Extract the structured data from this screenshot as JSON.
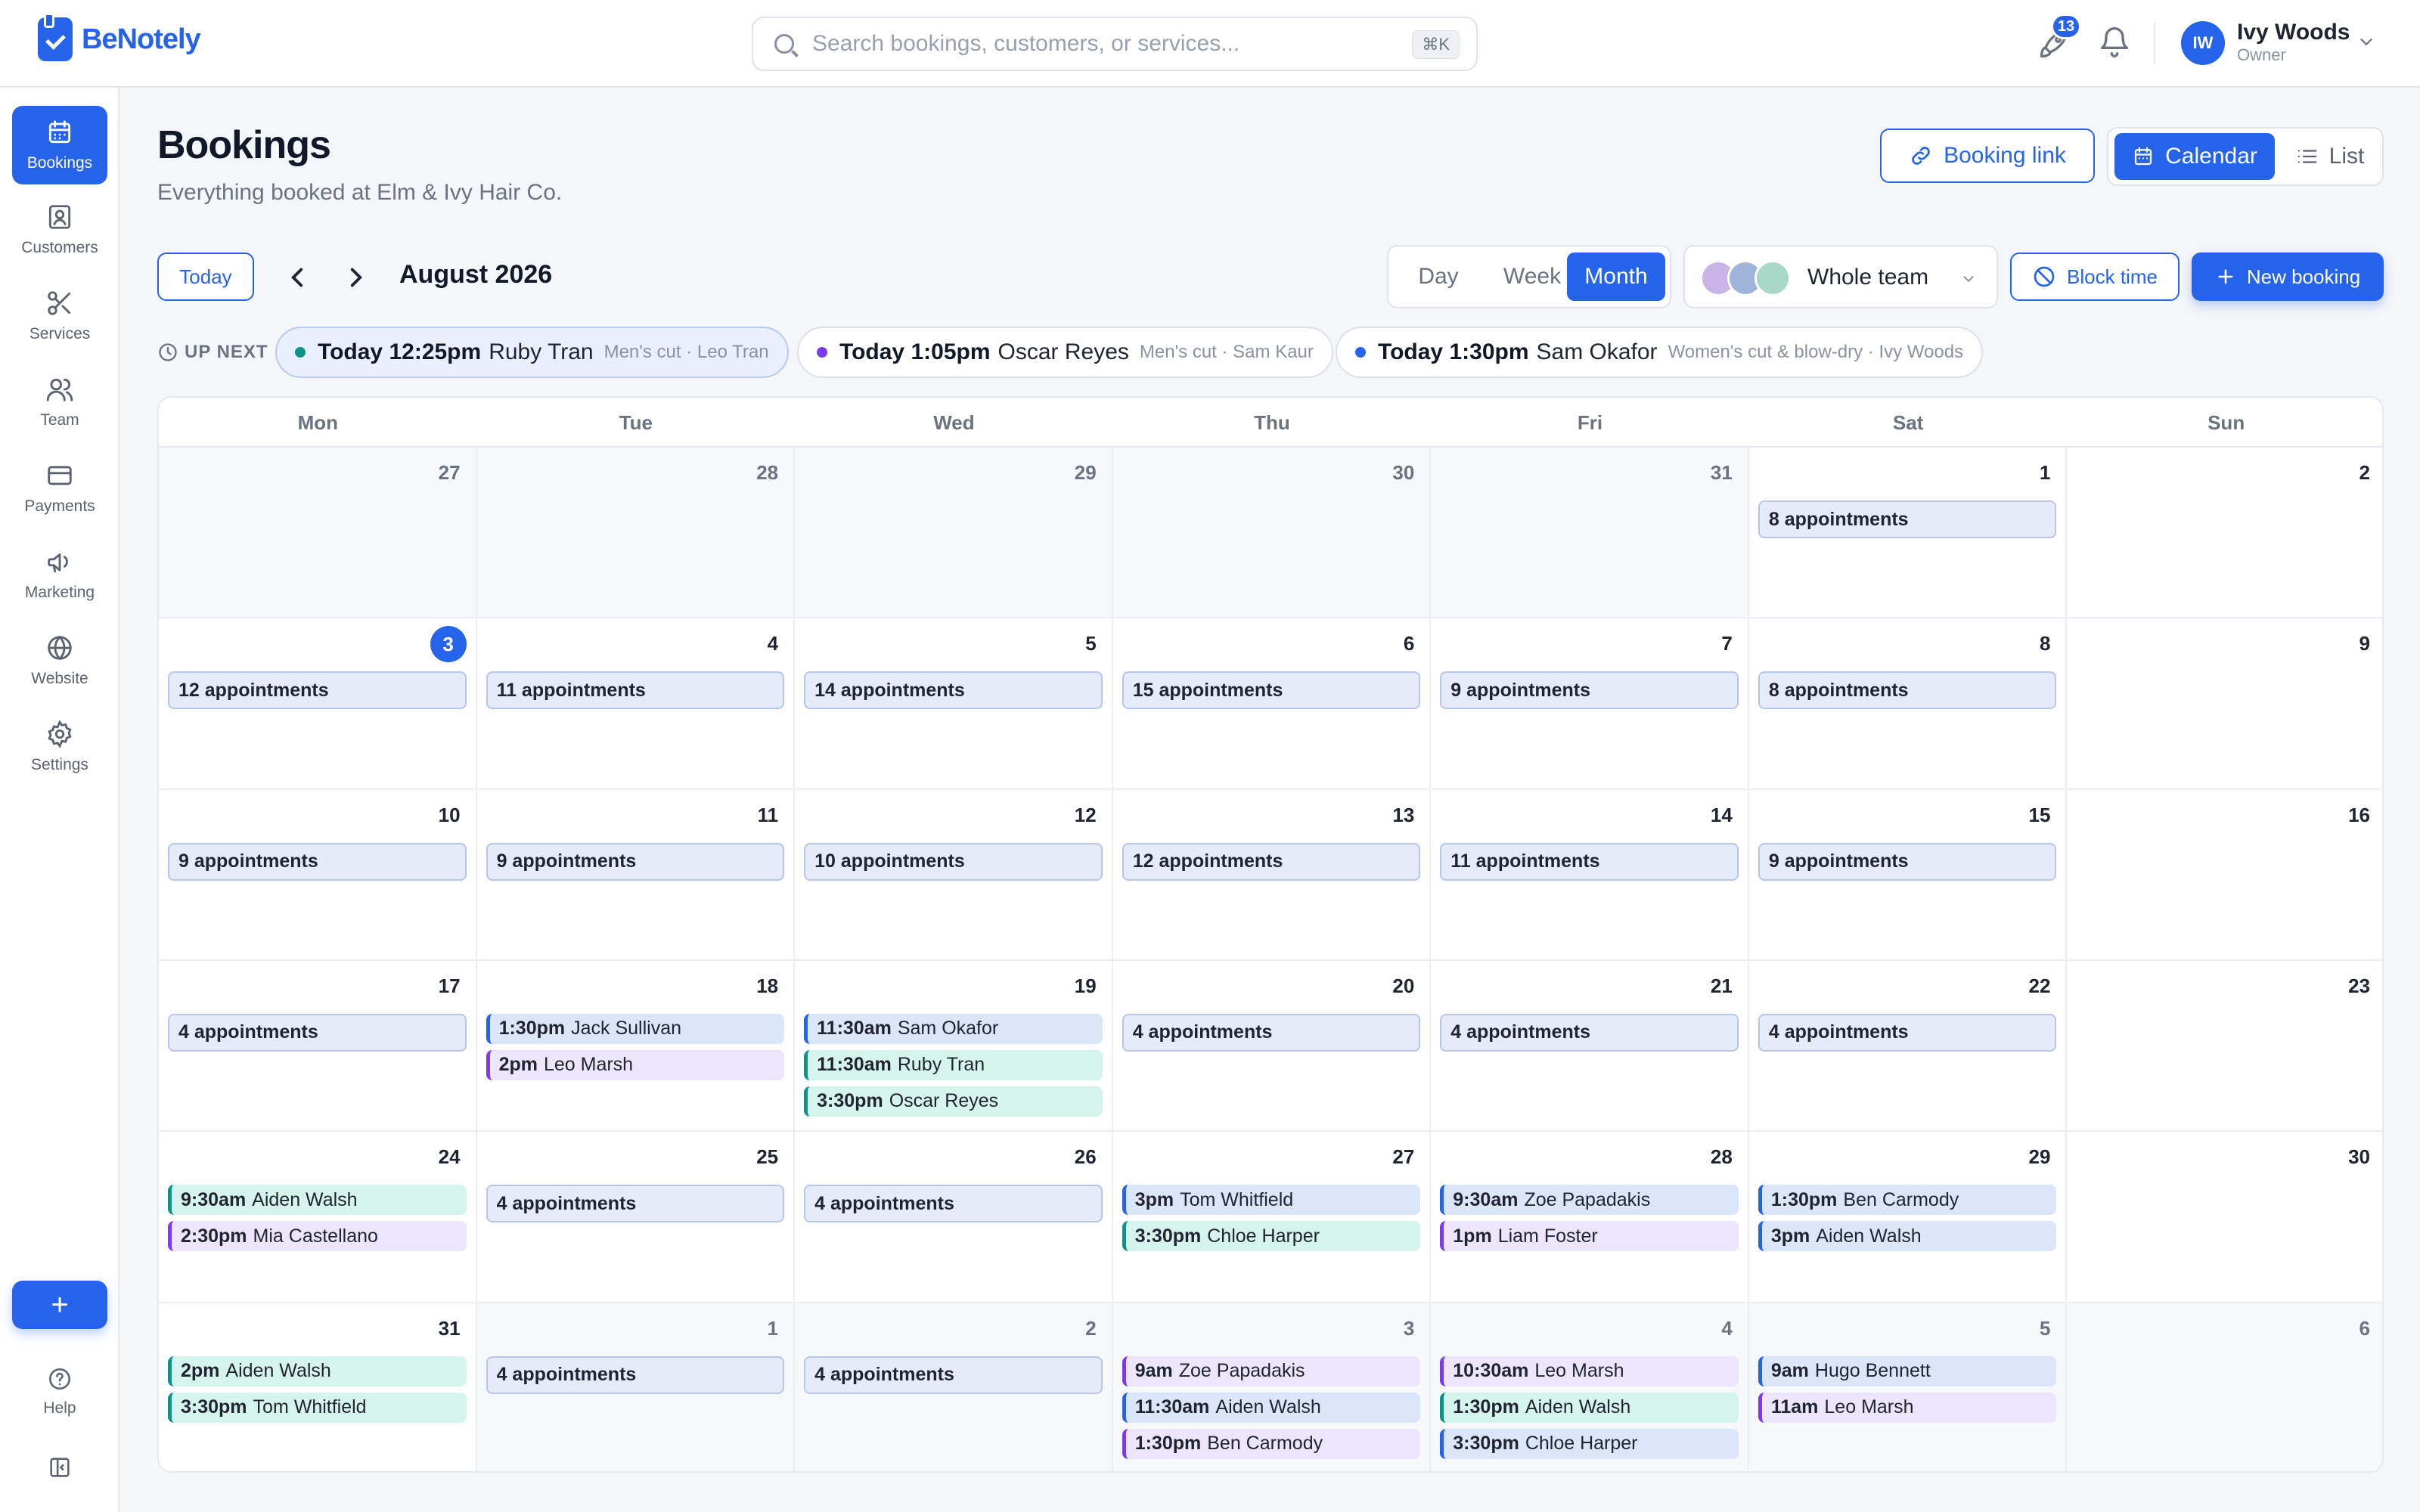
{
  "app": {
    "name": "BeNotely"
  },
  "search": {
    "placeholder": "Search bookings, customers, or services...",
    "shortcut": "⌘K"
  },
  "topbar": {
    "notifications_count": "13"
  },
  "user": {
    "initials": "IW",
    "name": "Ivy Woods",
    "role": "Owner"
  },
  "sidebar": {
    "items": [
      {
        "label": "Bookings",
        "icon": "calendar-icon",
        "active": true
      },
      {
        "label": "Customers",
        "icon": "contact-icon"
      },
      {
        "label": "Services",
        "icon": "scissors-icon"
      },
      {
        "label": "Team",
        "icon": "users-icon"
      },
      {
        "label": "Payments",
        "icon": "credit-card-icon"
      },
      {
        "label": "Marketing",
        "icon": "megaphone-icon"
      },
      {
        "label": "Website",
        "icon": "globe-icon"
      },
      {
        "label": "Settings",
        "icon": "gear-icon"
      }
    ],
    "add_label": "+",
    "help_label": "Help"
  },
  "header": {
    "title": "Bookings",
    "subtitle": "Everything booked at Elm & Ivy Hair Co.",
    "booking_link_label": "Booking link",
    "view_calendar_label": "Calendar",
    "view_list_label": "List"
  },
  "controls": {
    "today_label": "Today",
    "month_label": "August 2026",
    "range_day": "Day",
    "range_week": "Week",
    "range_month": "Month",
    "team_label": "Whole team",
    "block_time_label": "Block time",
    "new_booking_label": "New booking"
  },
  "up_next": {
    "label": "UP NEXT",
    "items": [
      {
        "time": "Today 12:25pm",
        "name": "Ruby Tran",
        "detail": "Men's cut · Leo Tran",
        "color": "#0d9488"
      },
      {
        "time": "Today 1:05pm",
        "name": "Oscar Reyes",
        "detail": "Men's cut · Sam Kaur",
        "color": "#7c3aed"
      },
      {
        "time": "Today 1:30pm",
        "name": "Sam Okafor",
        "detail": "Women's cut & blow-dry · Ivy Woods",
        "color": "#2563eb"
      }
    ]
  },
  "calendar": {
    "weekdays": [
      "Mon",
      "Tue",
      "Wed",
      "Thu",
      "Fri",
      "Sat",
      "Sun"
    ],
    "days": [
      {
        "date": "27",
        "muted": true
      },
      {
        "date": "28",
        "muted": true
      },
      {
        "date": "29",
        "muted": true
      },
      {
        "date": "30",
        "muted": true
      },
      {
        "date": "31",
        "muted": true
      },
      {
        "date": "1",
        "count": "8 appointments"
      },
      {
        "date": "2"
      },
      {
        "date": "3",
        "today": true,
        "count": "12 appointments"
      },
      {
        "date": "4",
        "count": "11 appointments"
      },
      {
        "date": "5",
        "count": "14 appointments"
      },
      {
        "date": "6",
        "count": "15 appointments"
      },
      {
        "date": "7",
        "count": "9 appointments"
      },
      {
        "date": "8",
        "count": "8 appointments"
      },
      {
        "date": "9"
      },
      {
        "date": "10",
        "count": "9 appointments"
      },
      {
        "date": "11",
        "count": "9 appointments"
      },
      {
        "date": "12",
        "count": "10 appointments"
      },
      {
        "date": "13",
        "count": "12 appointments"
      },
      {
        "date": "14",
        "count": "11 appointments"
      },
      {
        "date": "15",
        "count": "9 appointments"
      },
      {
        "date": "16"
      },
      {
        "date": "17",
        "count": "4 appointments"
      },
      {
        "date": "18",
        "events": [
          {
            "time": "1:30pm",
            "name": "Jack Sullivan",
            "color": "blue"
          },
          {
            "time": "2pm",
            "name": "Leo Marsh",
            "color": "purple"
          }
        ]
      },
      {
        "date": "19",
        "events": [
          {
            "time": "11:30am",
            "name": "Sam Okafor",
            "color": "blue"
          },
          {
            "time": "11:30am",
            "name": "Ruby Tran",
            "color": "teal"
          },
          {
            "time": "3:30pm",
            "name": "Oscar Reyes",
            "color": "teal"
          }
        ]
      },
      {
        "date": "20",
        "count": "4 appointments"
      },
      {
        "date": "21",
        "count": "4 appointments"
      },
      {
        "date": "22",
        "count": "4 appointments"
      },
      {
        "date": "23"
      },
      {
        "date": "24",
        "events": [
          {
            "time": "9:30am",
            "name": "Aiden Walsh",
            "color": "teal"
          },
          {
            "time": "2:30pm",
            "name": "Mia Castellano",
            "color": "purple"
          }
        ]
      },
      {
        "date": "25",
        "count": "4 appointments"
      },
      {
        "date": "26",
        "count": "4 appointments"
      },
      {
        "date": "27",
        "events": [
          {
            "time": "3pm",
            "name": "Tom Whitfield",
            "color": "blue"
          },
          {
            "time": "3:30pm",
            "name": "Chloe Harper",
            "color": "teal"
          }
        ]
      },
      {
        "date": "28",
        "events": [
          {
            "time": "9:30am",
            "name": "Zoe Papadakis",
            "color": "blue"
          },
          {
            "time": "1pm",
            "name": "Liam Foster",
            "color": "purple"
          }
        ]
      },
      {
        "date": "29",
        "events": [
          {
            "time": "1:30pm",
            "name": "Ben Carmody",
            "color": "blue"
          },
          {
            "time": "3pm",
            "name": "Aiden Walsh",
            "color": "blue"
          }
        ]
      },
      {
        "date": "30"
      },
      {
        "date": "31",
        "events": [
          {
            "time": "2pm",
            "name": "Aiden Walsh",
            "color": "teal"
          },
          {
            "time": "3:30pm",
            "name": "Tom Whitfield",
            "color": "teal"
          }
        ]
      },
      {
        "date": "1",
        "muted": true,
        "count": "4 appointments"
      },
      {
        "date": "2",
        "muted": true,
        "count": "4 appointments"
      },
      {
        "date": "3",
        "muted": true,
        "events": [
          {
            "time": "9am",
            "name": "Zoe Papadakis",
            "color": "purple"
          },
          {
            "time": "11:30am",
            "name": "Aiden Walsh",
            "color": "blue"
          },
          {
            "time": "1:30pm",
            "name": "Ben Carmody",
            "color": "purple"
          }
        ]
      },
      {
        "date": "4",
        "muted": true,
        "events": [
          {
            "time": "10:30am",
            "name": "Leo Marsh",
            "color": "purple"
          },
          {
            "time": "1:30pm",
            "name": "Aiden Walsh",
            "color": "teal"
          },
          {
            "time": "3:30pm",
            "name": "Chloe Harper",
            "color": "blue"
          }
        ]
      },
      {
        "date": "5",
        "muted": true,
        "events": [
          {
            "time": "9am",
            "name": "Hugo Bennett",
            "color": "blue"
          },
          {
            "time": "11am",
            "name": "Leo Marsh",
            "color": "purple"
          }
        ]
      },
      {
        "date": "6",
        "muted": true
      }
    ]
  },
  "colors": {
    "accent": "#2563eb",
    "teal": "#0d9488",
    "purple": "#7c3aed"
  }
}
